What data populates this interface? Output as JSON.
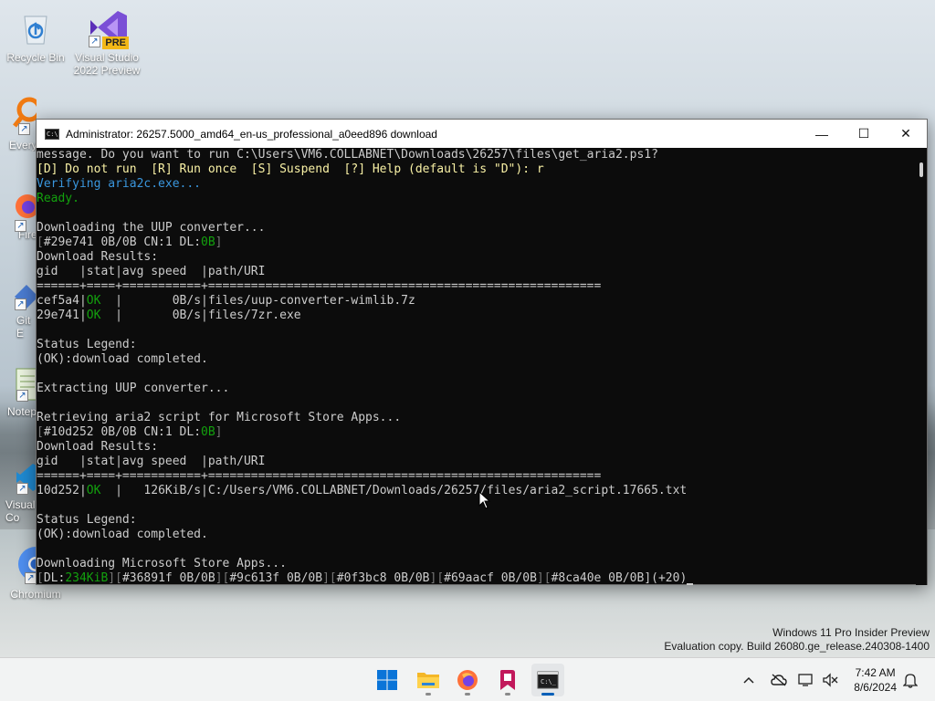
{
  "desktop": {
    "icons": [
      {
        "label": "Recycle Bin"
      },
      {
        "label": "Visual Studio 2022 Preview",
        "badge": "PRE"
      },
      {
        "label": "Every"
      },
      {
        "label": "Fire"
      },
      {
        "label": "Git E"
      },
      {
        "label": "Notep"
      },
      {
        "label": "Visual Co"
      },
      {
        "label": "Chromium"
      }
    ]
  },
  "window": {
    "title": "Administrator:  26257.5000_amd64_en-us_professional_a0eed896 download",
    "icon": "cmd-icon",
    "controls": {
      "minimize": "—",
      "maximize": "☐",
      "close": "✕"
    }
  },
  "console": {
    "lines": [
      [
        {
          "t": "message. Do you want to run C:\\Users\\VM6.COLLABNET\\Downloads\\26257\\files\\get_aria2.ps1?",
          "c": "def"
        }
      ],
      [
        {
          "t": "[D] Do not run  [R] Run once  [S] Suspend  [?] Help (default is \"D\"): r",
          "c": "yel"
        }
      ],
      [
        {
          "t": "Verifying aria2c.exe...",
          "c": "cyan"
        }
      ],
      [
        {
          "t": "Ready.",
          "c": "green"
        }
      ],
      [
        {
          "t": "",
          "c": "def"
        }
      ],
      [
        {
          "t": "Downloading the UUP converter...",
          "c": "def"
        }
      ],
      [
        {
          "t": "[",
          "c": "dim"
        },
        {
          "t": "#29e741 0B/0B CN:1 DL:",
          "c": "def"
        },
        {
          "t": "0B",
          "c": "green"
        },
        {
          "t": "]",
          "c": "dim"
        }
      ],
      [
        {
          "t": "Download Results:",
          "c": "def"
        }
      ],
      [
        {
          "t": "gid   |stat|avg speed  |path/URI",
          "c": "def"
        }
      ],
      [
        {
          "t": "======+====+===========+=======================================================",
          "c": "def"
        }
      ],
      [
        {
          "t": "cef5a4|",
          "c": "def"
        },
        {
          "t": "OK",
          "c": "green"
        },
        {
          "t": "  |       0B/s|files/uup-converter-wimlib.7z",
          "c": "def"
        }
      ],
      [
        {
          "t": "29e741|",
          "c": "def"
        },
        {
          "t": "OK",
          "c": "green"
        },
        {
          "t": "  |       0B/s|files/7zr.exe",
          "c": "def"
        }
      ],
      [
        {
          "t": "",
          "c": "def"
        }
      ],
      [
        {
          "t": "Status Legend:",
          "c": "def"
        }
      ],
      [
        {
          "t": "(OK):download completed.",
          "c": "def"
        }
      ],
      [
        {
          "t": "",
          "c": "def"
        }
      ],
      [
        {
          "t": "Extracting UUP converter...",
          "c": "def"
        }
      ],
      [
        {
          "t": "",
          "c": "def"
        }
      ],
      [
        {
          "t": "Retrieving aria2 script for Microsoft Store Apps...",
          "c": "def"
        }
      ],
      [
        {
          "t": "[",
          "c": "dim"
        },
        {
          "t": "#10d252 0B/0B CN:1 DL:",
          "c": "def"
        },
        {
          "t": "0B",
          "c": "green"
        },
        {
          "t": "]",
          "c": "dim"
        }
      ],
      [
        {
          "t": "Download Results:",
          "c": "def"
        }
      ],
      [
        {
          "t": "gid   |stat|avg speed  |path/URI",
          "c": "def"
        }
      ],
      [
        {
          "t": "======+====+===========+=======================================================",
          "c": "def"
        }
      ],
      [
        {
          "t": "10d252|",
          "c": "def"
        },
        {
          "t": "OK",
          "c": "green"
        },
        {
          "t": "  |   126KiB/s|C:/Users/VM6.COLLABNET/Downloads/26257/files/aria2_script.17665.txt",
          "c": "def"
        }
      ],
      [
        {
          "t": "",
          "c": "def"
        }
      ],
      [
        {
          "t": "Status Legend:",
          "c": "def"
        }
      ],
      [
        {
          "t": "(OK):download completed.",
          "c": "def"
        }
      ],
      [
        {
          "t": "",
          "c": "def"
        }
      ],
      [
        {
          "t": "Downloading Microsoft Store Apps...",
          "c": "def"
        }
      ],
      [
        {
          "t": "[",
          "c": "dim"
        },
        {
          "t": "DL:",
          "c": "def"
        },
        {
          "t": "234KiB",
          "c": "green"
        },
        {
          "t": "][",
          "c": "dim"
        },
        {
          "t": "#36891f 0B/0B",
          "c": "def"
        },
        {
          "t": "][",
          "c": "dim"
        },
        {
          "t": "#9c613f 0B/0B",
          "c": "def"
        },
        {
          "t": "][",
          "c": "dim"
        },
        {
          "t": "#0f3bc8 0B/0B",
          "c": "def"
        },
        {
          "t": "][",
          "c": "dim"
        },
        {
          "t": "#69aacf 0B/0B",
          "c": "def"
        },
        {
          "t": "][",
          "c": "dim"
        },
        {
          "t": "#8ca40e 0B/0B",
          "c": "def"
        },
        {
          "t": "](+20)",
          "c": "def"
        }
      ]
    ]
  },
  "watermark": {
    "line1": "Windows 11 Pro Insider Preview",
    "line2": "Evaluation copy. Build 26080.ge_release.240308-1400"
  },
  "taskbar": {
    "apps": [
      {
        "name": "start-button",
        "icon": "windows-logo-icon"
      },
      {
        "name": "file-explorer",
        "icon": "folder-icon"
      },
      {
        "name": "firefox",
        "icon": "firefox-icon"
      },
      {
        "name": "app-bookmark",
        "icon": "bookmark-icon"
      },
      {
        "name": "terminal",
        "icon": "terminal-icon"
      }
    ],
    "tray": {
      "chevron": "^",
      "time": "7:42 AM",
      "date": "8/6/2024"
    }
  },
  "colors": {
    "console_bg": "#0c0c0c",
    "console_fg": "#cccccc",
    "yellow": "#f9f1a5",
    "cyan": "#3a96dd",
    "green": "#13a10e",
    "accent": "#005fb8"
  }
}
